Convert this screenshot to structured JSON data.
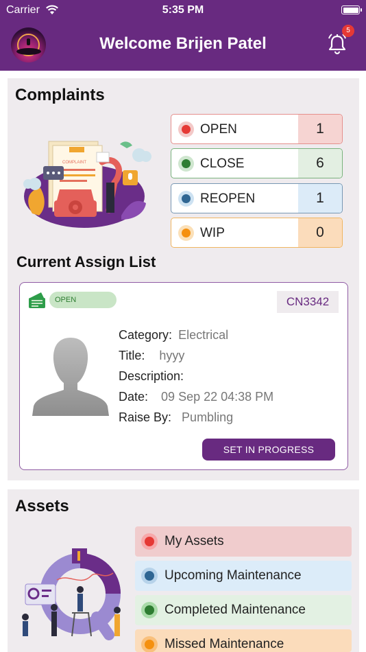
{
  "status_bar": {
    "carrier": "Carrier",
    "time": "5:35 PM"
  },
  "header": {
    "title": "Welcome Brijen Patel",
    "notification_count": "5"
  },
  "complaints": {
    "title": "Complaints",
    "stats": [
      {
        "label": "OPEN",
        "count": "1",
        "color": "#e53935"
      },
      {
        "label": "CLOSE",
        "count": "6",
        "color": "#2e7d32"
      },
      {
        "label": "REOPEN",
        "count": "1",
        "color": "#2f6693"
      },
      {
        "label": "WIP",
        "count": "0",
        "color": "#f5900f"
      }
    ]
  },
  "assign_list": {
    "title": "Current Assign List",
    "status": "OPEN",
    "complaint_no": "CN3342",
    "fields": [
      {
        "label": "Category:",
        "value": "Electrical"
      },
      {
        "label": "Title:",
        "value": "hyyy"
      },
      {
        "label": "Description:",
        "value": ""
      },
      {
        "label": "Date:",
        "value": "09 Sep 22 04:38 PM"
      },
      {
        "label": "Raise By:",
        "value": "Pumbling"
      }
    ],
    "action_label": "SET IN PROGRESS"
  },
  "assets": {
    "title": "Assets",
    "items": [
      {
        "label": "My Assets",
        "color": "#e53935"
      },
      {
        "label": "Upcoming Maintenance",
        "color": "#2f6693"
      },
      {
        "label": "Completed Maintenance",
        "color": "#2e7d32"
      },
      {
        "label": "Missed Maintenance",
        "color": "#f5900f"
      }
    ]
  },
  "illustrations": {
    "complaint_image_text": "COMPLAINT"
  }
}
